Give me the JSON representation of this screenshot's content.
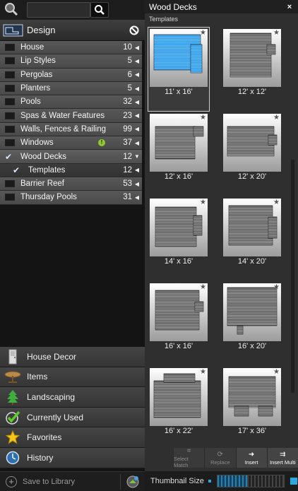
{
  "search": {
    "value": "",
    "placeholder": ""
  },
  "design": {
    "label": "Design"
  },
  "tree": [
    {
      "label": "House",
      "count": "10",
      "checked": false,
      "arrow": "◀"
    },
    {
      "label": "Lip Styles",
      "count": "5",
      "checked": false,
      "arrow": "◀"
    },
    {
      "label": "Pergolas",
      "count": "6",
      "checked": false,
      "arrow": "◀"
    },
    {
      "label": "Planters",
      "count": "5",
      "checked": false,
      "arrow": "◀"
    },
    {
      "label": "Pools",
      "count": "32",
      "checked": false,
      "arrow": "◀"
    },
    {
      "label": "Spas & Water Features",
      "count": "23",
      "checked": false,
      "arrow": "◀"
    },
    {
      "label": "Walls, Fences & Railing",
      "count": "99",
      "checked": false,
      "arrow": "◀"
    },
    {
      "label": "Windows",
      "count": "37",
      "checked": false,
      "arrow": "◀",
      "badge": "!"
    },
    {
      "label": "Wood Decks",
      "count": "12",
      "checked": true,
      "arrow": "▼"
    },
    {
      "label": "Templates",
      "count": "12",
      "checked": true,
      "arrow": "◀",
      "sub": true
    },
    {
      "label": "Barrier Reef",
      "count": "53",
      "checked": false,
      "arrow": "◀"
    },
    {
      "label": "Thursday Pools",
      "count": "31",
      "checked": false,
      "arrow": "◀"
    }
  ],
  "categories": [
    {
      "label": "House Decor",
      "icon": "door-icon"
    },
    {
      "label": "Items",
      "icon": "table-icon"
    },
    {
      "label": "Landscaping",
      "icon": "tree-icon"
    },
    {
      "label": "Currently Used",
      "icon": "checkmark-icon"
    },
    {
      "label": "Favorites",
      "icon": "star-icon"
    },
    {
      "label": "History",
      "icon": "history-icon"
    }
  ],
  "library": {
    "label": "Save to Library"
  },
  "panel": {
    "title": "Wood Decks",
    "close": "×",
    "subtitle": "Templates"
  },
  "thumbnails": [
    {
      "caption": "11' x 16'",
      "selected": true
    },
    {
      "caption": "12' x 12'",
      "selected": false
    },
    {
      "caption": "12' x 16'",
      "selected": false
    },
    {
      "caption": "12' x 20'",
      "selected": false
    },
    {
      "caption": "14' x 16'",
      "selected": false
    },
    {
      "caption": "14' x 20'",
      "selected": false
    },
    {
      "caption": "16' x 16'",
      "selected": false
    },
    {
      "caption": "16' x 20'",
      "selected": false
    },
    {
      "caption": "16' x 22'",
      "selected": false
    },
    {
      "caption": "17' x 36'",
      "selected": false
    }
  ],
  "actions": [
    {
      "label": "Select Match",
      "enabled": false,
      "icon": "select-match-icon"
    },
    {
      "label": "Replace",
      "enabled": false,
      "icon": "replace-icon"
    },
    {
      "label": "Insert",
      "enabled": true,
      "icon": "insert-icon"
    },
    {
      "label": "Insert Multi",
      "enabled": true,
      "icon": "insert-multi-icon"
    }
  ],
  "thumbnail_size": {
    "label": "Thumbnail Size",
    "level": 0.45
  },
  "colors": {
    "accent": "#2aa9e0",
    "selected_deck": "#2a9be8"
  }
}
